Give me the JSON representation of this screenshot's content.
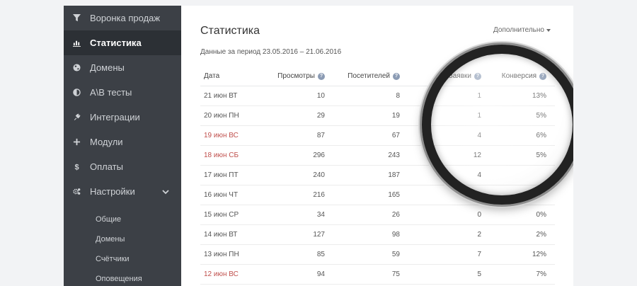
{
  "sidebar": {
    "items": [
      {
        "label": "Воронка продаж",
        "icon": "funnel-icon",
        "active": false
      },
      {
        "label": "Статистика",
        "icon": "bar-chart-icon",
        "active": true
      },
      {
        "label": "Домены",
        "icon": "globe-icon",
        "active": false
      },
      {
        "label": "A\\B тесты",
        "icon": "half-circle-icon",
        "active": false
      },
      {
        "label": "Интеграции",
        "icon": "plug-icon",
        "active": false
      },
      {
        "label": "Модули",
        "icon": "plus-icon",
        "active": false
      },
      {
        "label": "Оплаты",
        "icon": "dollar-icon",
        "active": false
      },
      {
        "label": "Настройки",
        "icon": "gears-icon",
        "active": false,
        "expanded": true
      }
    ],
    "settings_sub": [
      "Общие",
      "Домены",
      "Счётчики",
      "Оповещения"
    ]
  },
  "main": {
    "title": "Статистика",
    "more_label": "Дополнительно",
    "period": "Данные за период 23.05.2016 – 21.06.2016",
    "columns": [
      "Дата",
      "Просмотры",
      "Посетителей",
      "Заявки",
      "Конверсия"
    ],
    "rows": [
      {
        "date": "21 июн ВТ",
        "views": "10",
        "visitors": "8",
        "leads": "1",
        "conv": "13%",
        "weekend": false
      },
      {
        "date": "20 июн ПН",
        "views": "29",
        "visitors": "19",
        "leads": "1",
        "conv": "5%",
        "weekend": false
      },
      {
        "date": "19 июн ВС",
        "views": "87",
        "visitors": "67",
        "leads": "4",
        "conv": "6%",
        "weekend": true
      },
      {
        "date": "18 июн СБ",
        "views": "296",
        "visitors": "243",
        "leads": "12",
        "conv": "5%",
        "weekend": true
      },
      {
        "date": "17 июн ПТ",
        "views": "240",
        "visitors": "187",
        "leads": "4",
        "conv": "",
        "weekend": false
      },
      {
        "date": "16 июн ЧТ",
        "views": "216",
        "visitors": "165",
        "leads": "",
        "conv": "",
        "weekend": false
      },
      {
        "date": "15 июн СР",
        "views": "34",
        "visitors": "26",
        "leads": "0",
        "conv": "0%",
        "weekend": false
      },
      {
        "date": "14 июн ВТ",
        "views": "127",
        "visitors": "98",
        "leads": "2",
        "conv": "2%",
        "weekend": false
      },
      {
        "date": "13 июн ПН",
        "views": "85",
        "visitors": "59",
        "leads": "7",
        "conv": "12%",
        "weekend": false
      },
      {
        "date": "12 июн ВС",
        "views": "94",
        "visitors": "75",
        "leads": "5",
        "conv": "7%",
        "weekend": true
      }
    ]
  },
  "colors": {
    "sidebar_bg": "#3c4046",
    "sidebar_active": "#2c3035",
    "weekend_text": "#c0504d",
    "help_badge": "#8b9bb4"
  }
}
